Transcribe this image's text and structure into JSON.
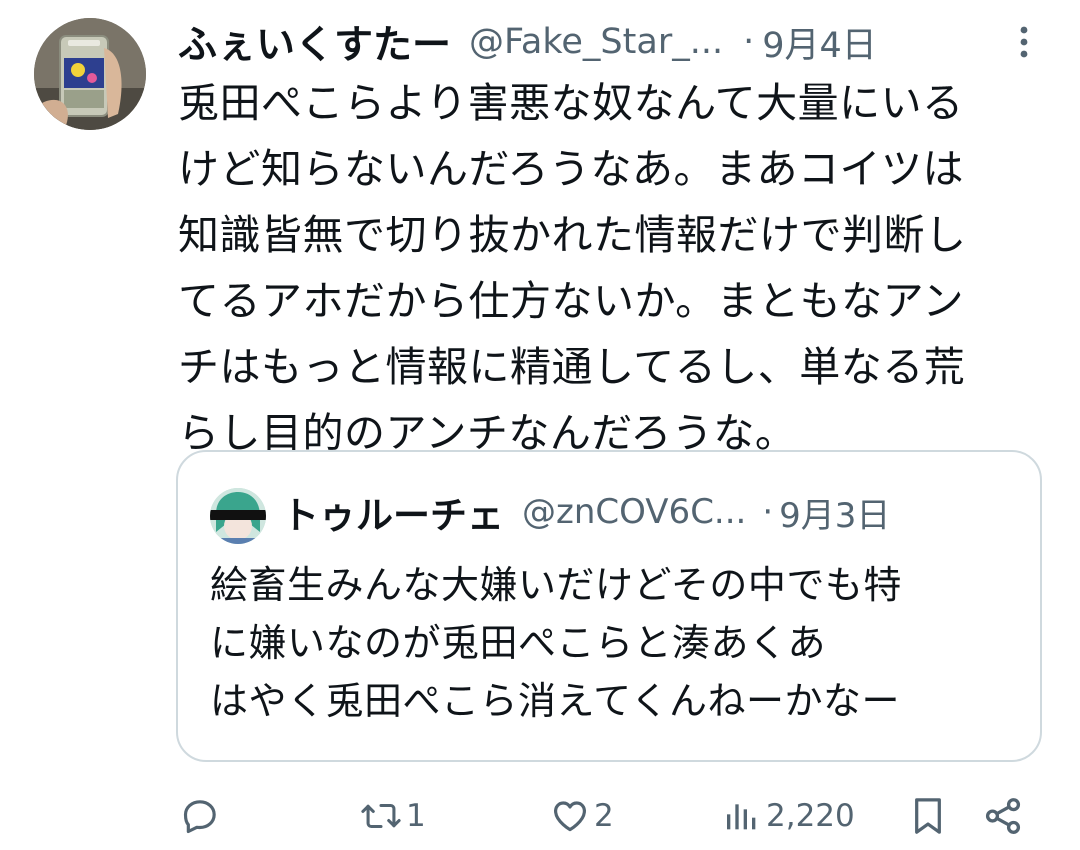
{
  "tweet": {
    "display_name": "ふぇいくすたー",
    "handle": "@Fake_Star_...",
    "separator": "·",
    "date": "9月4日",
    "text_lines": [
      "兎田ぺこらより害悪な奴なんて大量にいる",
      "けど知らないんだろうなあ。まあコイツは",
      "知識皆無で切り抜かれた情報だけで判断し",
      "てるアホだから仕方ないか。まともなアン",
      "チはもっと情報に精通してるし、単なる荒",
      "らし目的のアンチなんだろうな。"
    ],
    "avatar_icon": "avatar-can-photo",
    "more_icon": "more-vertical-icon"
  },
  "quoted": {
    "display_name": "トゥルーチェ",
    "handle": "@znCOV6C...",
    "separator": "·",
    "date": "9月3日",
    "text_lines": [
      "絵畜生みんな大嫌いだけどその中でも特",
      "に嫌いなのが兎田ぺこらと湊あくあ",
      "はやく兎田ぺこら消えてくんねーかなー"
    ]
  },
  "actions": {
    "reply_count": "",
    "retweet_count": "1",
    "like_count": "2",
    "views_count": "2,220"
  },
  "colors": {
    "text": "#0f1419",
    "secondary": "#536471",
    "border": "#cfd9de",
    "background": "#ffffff"
  }
}
